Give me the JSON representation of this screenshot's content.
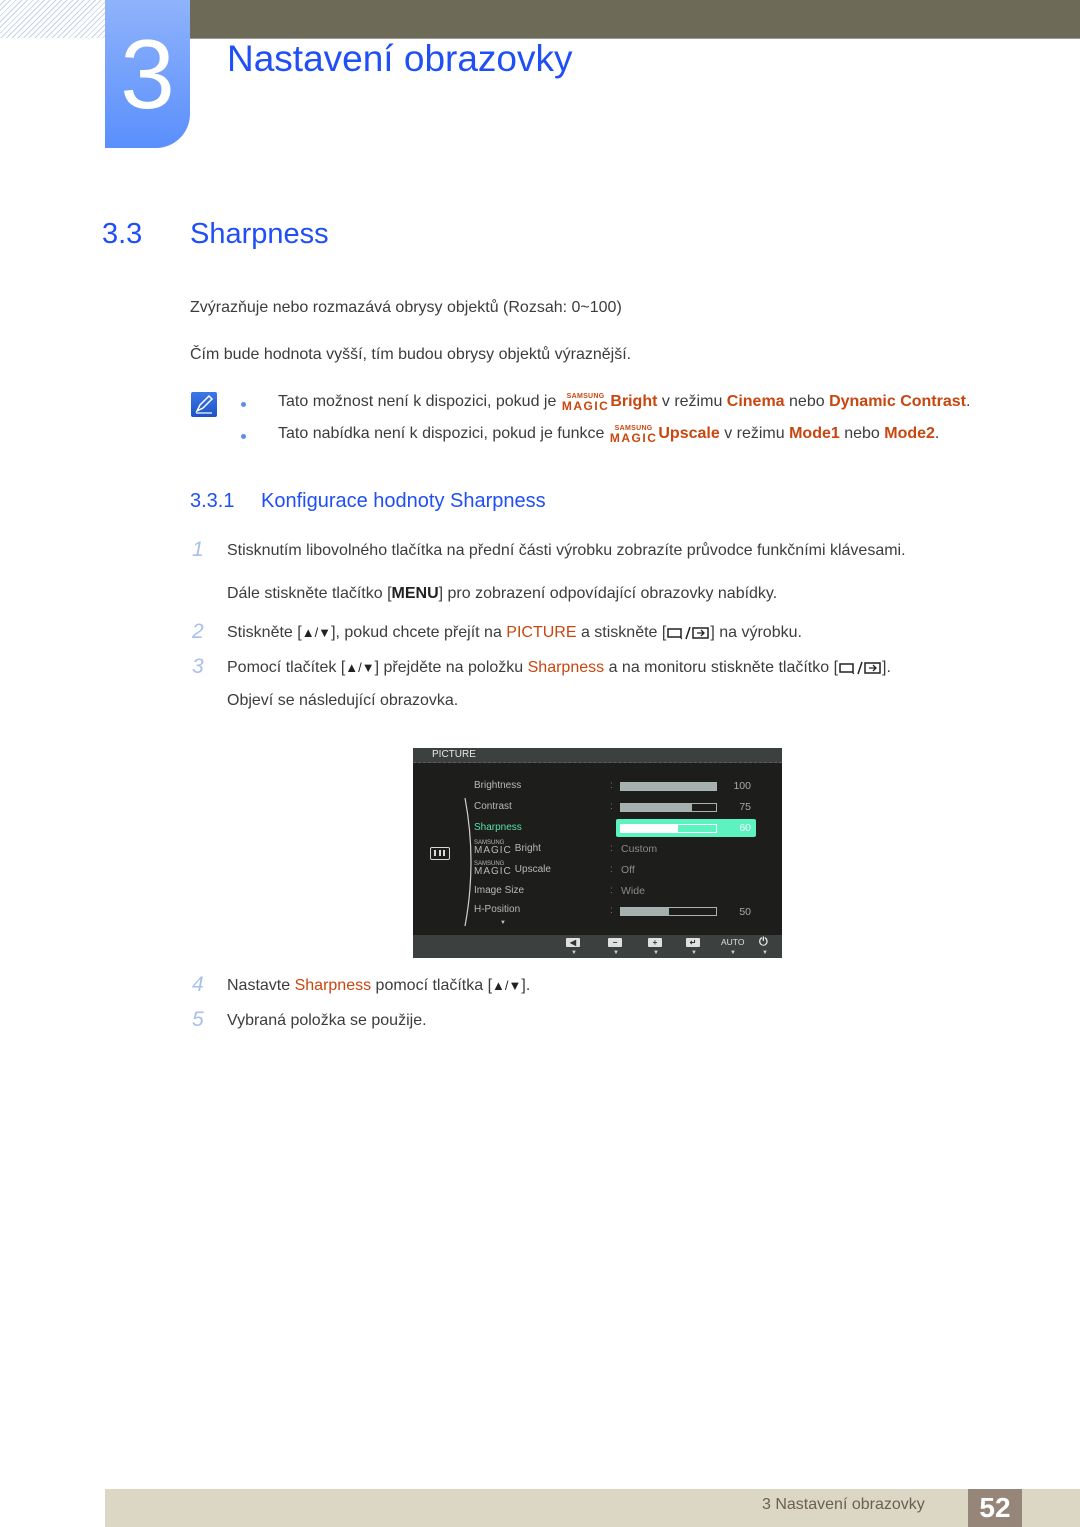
{
  "chapter": {
    "number": "3",
    "title": "Nastavení obrazovky"
  },
  "section": {
    "number": "3.3",
    "title": "Sharpness"
  },
  "intro": [
    "Zvýrazňuje nebo rozmazává obrysy objektů (Rozsah: 0~100)",
    "Čím bude hodnota vyšší, tím budou obrysy objektů výraznější."
  ],
  "notes": [
    {
      "pre": "Tato možnost není k dispozici, pokud je ",
      "magic_top": "SAMSUNG",
      "magic_bottom": "MAGIC",
      "feature": "Bright",
      "mid": " v režimu ",
      "opt1": "Cinema",
      "or": " nebo ",
      "opt2": "Dynamic Contrast",
      "end": "."
    },
    {
      "pre": "Tato nabídka není k dispozici, pokud je funkce ",
      "magic_top": "SAMSUNG",
      "magic_bottom": "MAGIC",
      "feature": "Upscale",
      "mid": " v režimu ",
      "opt1": "Mode1",
      "or": " nebo ",
      "opt2": "Mode2",
      "end": "."
    }
  ],
  "subsection": {
    "number": "3.3.1",
    "title": "Konfigurace hodnoty Sharpness"
  },
  "steps": {
    "s1": {
      "num": "1",
      "text": "Stisknutím libovolného tlačítka na přední části výrobku zobrazíte průvodce funkčními klávesami."
    },
    "s1b": {
      "pre": "Dále stiskněte tlačítko [",
      "key": "MENU",
      "post": "] pro zobrazení odpovídající obrazovky nabídky."
    },
    "s2": {
      "num": "2",
      "pre": "Stiskněte [",
      "arrows": "▲/▼",
      "mid": "], pokud chcete přejít na ",
      "hl": "PICTURE",
      "mid2": " a stiskněte [",
      "post": "] na výrobku."
    },
    "s3": {
      "num": "3",
      "pre": "Pomocí tlačítek [",
      "arrows": "▲/▼",
      "mid": "] přejděte na položku ",
      "hl": "Sharpness",
      "mid2": " a na monitoru stiskněte tlačítko [",
      "post": "]."
    },
    "s3b": {
      "text": "Objeví se následující obrazovka."
    },
    "s4": {
      "num": "4",
      "pre": "Nastavte ",
      "hl": "Sharpness",
      "mid": " pomocí tlačítka [",
      "arrows": "▲/▼",
      "post": "]."
    },
    "s5": {
      "num": "5",
      "text": "Vybraná položka se použije."
    }
  },
  "osd": {
    "header": "PICTURE",
    "items": [
      {
        "label": "Brightness",
        "type": "bar",
        "value": 100
      },
      {
        "label": "Contrast",
        "type": "bar",
        "value": 75
      },
      {
        "label": "Sharpness",
        "type": "bar",
        "value": 60,
        "selected": true
      },
      {
        "label": "Bright",
        "magic": true,
        "type": "text",
        "text": "Custom"
      },
      {
        "label": "Upscale",
        "magic": true,
        "type": "text",
        "text": "Off"
      },
      {
        "label": "Image Size",
        "type": "text",
        "text": "Wide"
      },
      {
        "label": "H-Position",
        "type": "bar",
        "value": 50
      }
    ],
    "magic_top": "SAMSUNG",
    "magic_bottom": "MAGIC",
    "colon": ":",
    "footer_buttons": [
      "left-arrow",
      "minus",
      "plus",
      "enter",
      "AUTO",
      "power"
    ],
    "auto_label": "AUTO"
  },
  "footer": {
    "label": "3 Nastavení obrazovky",
    "page": "52"
  }
}
